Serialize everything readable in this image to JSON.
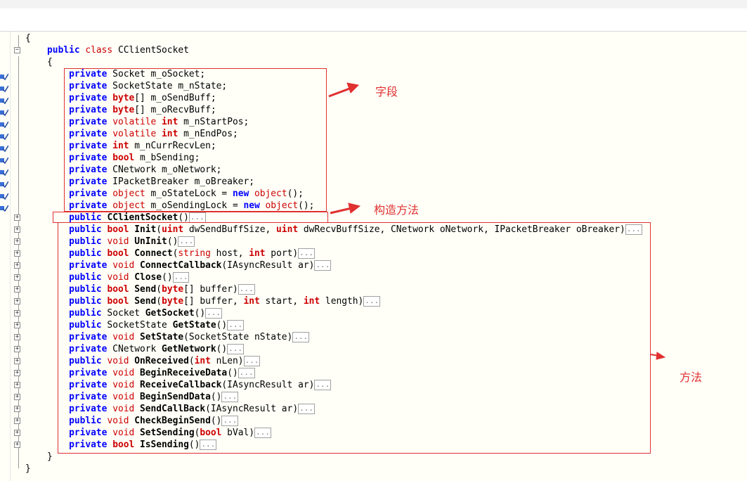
{
  "code_lines": [
    [
      {
        "t": "{",
        "c": "p"
      }
    ],
    [
      {
        "t": "    "
      },
      {
        "t": "public",
        "c": "kwb"
      },
      {
        "t": " "
      },
      {
        "t": "class",
        "c": "ty"
      },
      {
        "t": " CClientSocket"
      }
    ],
    [
      {
        "t": "    {"
      }
    ],
    [
      {
        "t": "        "
      },
      {
        "t": "private",
        "c": "kwb"
      },
      {
        "t": " Socket m_oSocket;"
      }
    ],
    [
      {
        "t": "        "
      },
      {
        "t": "private",
        "c": "kwb"
      },
      {
        "t": " SocketState m_nState;"
      }
    ],
    [
      {
        "t": "        "
      },
      {
        "t": "private",
        "c": "kwb"
      },
      {
        "t": " "
      },
      {
        "t": "byte",
        "c": "tyb"
      },
      {
        "t": "[] m_oSendBuff;"
      }
    ],
    [
      {
        "t": "        "
      },
      {
        "t": "private",
        "c": "kwb"
      },
      {
        "t": " "
      },
      {
        "t": "byte",
        "c": "tyb"
      },
      {
        "t": "[] m_oRecvBuff;"
      }
    ],
    [
      {
        "t": "        "
      },
      {
        "t": "private",
        "c": "kwb"
      },
      {
        "t": " "
      },
      {
        "t": "volatile",
        "c": "ty"
      },
      {
        "t": " "
      },
      {
        "t": "int",
        "c": "tyb"
      },
      {
        "t": " m_nStartPos;"
      }
    ],
    [
      {
        "t": "        "
      },
      {
        "t": "private",
        "c": "kwb"
      },
      {
        "t": " "
      },
      {
        "t": "volatile",
        "c": "ty"
      },
      {
        "t": " "
      },
      {
        "t": "int",
        "c": "tyb"
      },
      {
        "t": " m_nEndPos;"
      }
    ],
    [
      {
        "t": "        "
      },
      {
        "t": "private",
        "c": "kwb"
      },
      {
        "t": " "
      },
      {
        "t": "int",
        "c": "tyb"
      },
      {
        "t": " m_nCurrRecvLen;"
      }
    ],
    [
      {
        "t": "        "
      },
      {
        "t": "private",
        "c": "kwb"
      },
      {
        "t": " "
      },
      {
        "t": "bool",
        "c": "tyb"
      },
      {
        "t": " m_bSending;"
      }
    ],
    [
      {
        "t": "        "
      },
      {
        "t": "private",
        "c": "kwb"
      },
      {
        "t": " CNetwork m_oNetwork;"
      }
    ],
    [
      {
        "t": "        "
      },
      {
        "t": "private",
        "c": "kwb"
      },
      {
        "t": " IPacketBreaker m_oBreaker;"
      }
    ],
    [
      {
        "t": "        "
      },
      {
        "t": "private",
        "c": "kwb"
      },
      {
        "t": " "
      },
      {
        "t": "object",
        "c": "ty"
      },
      {
        "t": " m_oStateLock = "
      },
      {
        "t": "new",
        "c": "kwb"
      },
      {
        "t": " "
      },
      {
        "t": "object",
        "c": "ty"
      },
      {
        "t": "();"
      }
    ],
    [
      {
        "t": "        "
      },
      {
        "t": "private",
        "c": "kwb"
      },
      {
        "t": " "
      },
      {
        "t": "object",
        "c": "ty"
      },
      {
        "t": " m_oSendingLock = "
      },
      {
        "t": "new",
        "c": "kwb"
      },
      {
        "t": " "
      },
      {
        "t": "object",
        "c": "ty"
      },
      {
        "t": "();"
      }
    ],
    [
      {
        "t": "        "
      },
      {
        "t": "public",
        "c": "kwb"
      },
      {
        "t": " "
      },
      {
        "t": "CClientSocket",
        "c": "nm"
      },
      {
        "t": "()"
      },
      {
        "t": "...",
        "c": "fold"
      }
    ],
    [
      {
        "t": "        "
      },
      {
        "t": "public",
        "c": "kwb"
      },
      {
        "t": " "
      },
      {
        "t": "bool",
        "c": "tyb"
      },
      {
        "t": " "
      },
      {
        "t": "Init",
        "c": "nm"
      },
      {
        "t": "("
      },
      {
        "t": "uint",
        "c": "tyb"
      },
      {
        "t": " dwSendBuffSize, "
      },
      {
        "t": "uint",
        "c": "tyb"
      },
      {
        "t": " dwRecvBuffSize, CNetwork oNetwork, IPacketBreaker oBreaker)"
      },
      {
        "t": "...",
        "c": "fold"
      }
    ],
    [
      {
        "t": "        "
      },
      {
        "t": "public",
        "c": "kwb"
      },
      {
        "t": " "
      },
      {
        "t": "void",
        "c": "ty"
      },
      {
        "t": " "
      },
      {
        "t": "UnInit",
        "c": "nm"
      },
      {
        "t": "()"
      },
      {
        "t": "...",
        "c": "fold"
      }
    ],
    [
      {
        "t": "        "
      },
      {
        "t": "public",
        "c": "kwb"
      },
      {
        "t": " "
      },
      {
        "t": "bool",
        "c": "tyb"
      },
      {
        "t": " "
      },
      {
        "t": "Connect",
        "c": "nm"
      },
      {
        "t": "("
      },
      {
        "t": "string",
        "c": "ty"
      },
      {
        "t": " host, "
      },
      {
        "t": "int",
        "c": "tyb"
      },
      {
        "t": " port)"
      },
      {
        "t": "...",
        "c": "fold"
      }
    ],
    [
      {
        "t": "        "
      },
      {
        "t": "private",
        "c": "kwb"
      },
      {
        "t": " "
      },
      {
        "t": "void",
        "c": "ty"
      },
      {
        "t": " "
      },
      {
        "t": "ConnectCallback",
        "c": "nm"
      },
      {
        "t": "(IAsyncResult ar)"
      },
      {
        "t": "...",
        "c": "fold"
      }
    ],
    [
      {
        "t": "        "
      },
      {
        "t": "public",
        "c": "kwb"
      },
      {
        "t": " "
      },
      {
        "t": "void",
        "c": "ty"
      },
      {
        "t": " "
      },
      {
        "t": "Close",
        "c": "nm"
      },
      {
        "t": "()"
      },
      {
        "t": "...",
        "c": "fold"
      }
    ],
    [
      {
        "t": "        "
      },
      {
        "t": "public",
        "c": "kwb"
      },
      {
        "t": " "
      },
      {
        "t": "bool",
        "c": "tyb"
      },
      {
        "t": " "
      },
      {
        "t": "Send",
        "c": "nm"
      },
      {
        "t": "("
      },
      {
        "t": "byte",
        "c": "tyb"
      },
      {
        "t": "[] buffer)"
      },
      {
        "t": "...",
        "c": "fold"
      }
    ],
    [
      {
        "t": "        "
      },
      {
        "t": "public",
        "c": "kwb"
      },
      {
        "t": " "
      },
      {
        "t": "bool",
        "c": "tyb"
      },
      {
        "t": " "
      },
      {
        "t": "Send",
        "c": "nm"
      },
      {
        "t": "("
      },
      {
        "t": "byte",
        "c": "tyb"
      },
      {
        "t": "[] buffer, "
      },
      {
        "t": "int",
        "c": "tyb"
      },
      {
        "t": " start, "
      },
      {
        "t": "int",
        "c": "tyb"
      },
      {
        "t": " length)"
      },
      {
        "t": "...",
        "c": "fold"
      }
    ],
    [
      {
        "t": "        "
      },
      {
        "t": "public",
        "c": "kwb"
      },
      {
        "t": " Socket "
      },
      {
        "t": "GetSocket",
        "c": "nm"
      },
      {
        "t": "()"
      },
      {
        "t": "...",
        "c": "fold"
      }
    ],
    [
      {
        "t": "        "
      },
      {
        "t": "public",
        "c": "kwb"
      },
      {
        "t": " SocketState "
      },
      {
        "t": "GetState",
        "c": "nm"
      },
      {
        "t": "()"
      },
      {
        "t": "...",
        "c": "fold"
      }
    ],
    [
      {
        "t": "        "
      },
      {
        "t": "private",
        "c": "kwb"
      },
      {
        "t": " "
      },
      {
        "t": "void",
        "c": "ty"
      },
      {
        "t": " "
      },
      {
        "t": "SetState",
        "c": "nm"
      },
      {
        "t": "(SocketState nState)"
      },
      {
        "t": "...",
        "c": "fold"
      }
    ],
    [
      {
        "t": "        "
      },
      {
        "t": "private",
        "c": "kwb"
      },
      {
        "t": " CNetwork "
      },
      {
        "t": "GetNetwork",
        "c": "nm"
      },
      {
        "t": "()"
      },
      {
        "t": "...",
        "c": "fold"
      }
    ],
    [
      {
        "t": "        "
      },
      {
        "t": "public",
        "c": "kwb"
      },
      {
        "t": " "
      },
      {
        "t": "void",
        "c": "ty"
      },
      {
        "t": " "
      },
      {
        "t": "OnReceived",
        "c": "nm"
      },
      {
        "t": "("
      },
      {
        "t": "int",
        "c": "tyb"
      },
      {
        "t": " nLen)"
      },
      {
        "t": "...",
        "c": "fold"
      }
    ],
    [
      {
        "t": "        "
      },
      {
        "t": "private",
        "c": "kwb"
      },
      {
        "t": " "
      },
      {
        "t": "void",
        "c": "ty"
      },
      {
        "t": " "
      },
      {
        "t": "BeginReceiveData",
        "c": "nm"
      },
      {
        "t": "()"
      },
      {
        "t": "...",
        "c": "fold"
      }
    ],
    [
      {
        "t": "        "
      },
      {
        "t": "private",
        "c": "kwb"
      },
      {
        "t": " "
      },
      {
        "t": "void",
        "c": "ty"
      },
      {
        "t": " "
      },
      {
        "t": "ReceiveCallback",
        "c": "nm"
      },
      {
        "t": "(IAsyncResult ar)"
      },
      {
        "t": "...",
        "c": "fold"
      }
    ],
    [
      {
        "t": "        "
      },
      {
        "t": "private",
        "c": "kwb"
      },
      {
        "t": " "
      },
      {
        "t": "void",
        "c": "ty"
      },
      {
        "t": " "
      },
      {
        "t": "BeginSendData",
        "c": "nm"
      },
      {
        "t": "()"
      },
      {
        "t": "...",
        "c": "fold"
      }
    ],
    [
      {
        "t": "        "
      },
      {
        "t": "private",
        "c": "kwb"
      },
      {
        "t": " "
      },
      {
        "t": "void",
        "c": "ty"
      },
      {
        "t": " "
      },
      {
        "t": "SendCallBack",
        "c": "nm"
      },
      {
        "t": "(IAsyncResult ar)"
      },
      {
        "t": "...",
        "c": "fold"
      }
    ],
    [
      {
        "t": "        "
      },
      {
        "t": "public",
        "c": "kwb"
      },
      {
        "t": " "
      },
      {
        "t": "void",
        "c": "ty"
      },
      {
        "t": " "
      },
      {
        "t": "CheckBeginSend",
        "c": "nm"
      },
      {
        "t": "()"
      },
      {
        "t": "...",
        "c": "fold"
      }
    ],
    [
      {
        "t": "        "
      },
      {
        "t": "private",
        "c": "kwb"
      },
      {
        "t": " "
      },
      {
        "t": "void",
        "c": "ty"
      },
      {
        "t": " "
      },
      {
        "t": "SetSending",
        "c": "nm"
      },
      {
        "t": "("
      },
      {
        "t": "bool",
        "c": "tyb"
      },
      {
        "t": " bVal)"
      },
      {
        "t": "...",
        "c": "fold"
      }
    ],
    [
      {
        "t": "        "
      },
      {
        "t": "private",
        "c": "kwb"
      },
      {
        "t": " "
      },
      {
        "t": "bool",
        "c": "tyb"
      },
      {
        "t": " "
      },
      {
        "t": "IsSending",
        "c": "nm"
      },
      {
        "t": "()"
      },
      {
        "t": "...",
        "c": "fold"
      }
    ],
    [
      {
        "t": "    }"
      }
    ],
    [
      {
        "t": "}"
      }
    ]
  ],
  "annotations": {
    "fields": "字段",
    "constructor": "构造方法",
    "methods": "方法"
  },
  "colors": {
    "keyword": "#0000ff",
    "type": "#cc0000",
    "annotation": "#e03030",
    "editor_bg": "#fffff8"
  },
  "icons": {
    "gutter_marker": "field-member-icon",
    "expand": "plus-toggle-icon",
    "collapse": "minus-toggle-icon"
  }
}
